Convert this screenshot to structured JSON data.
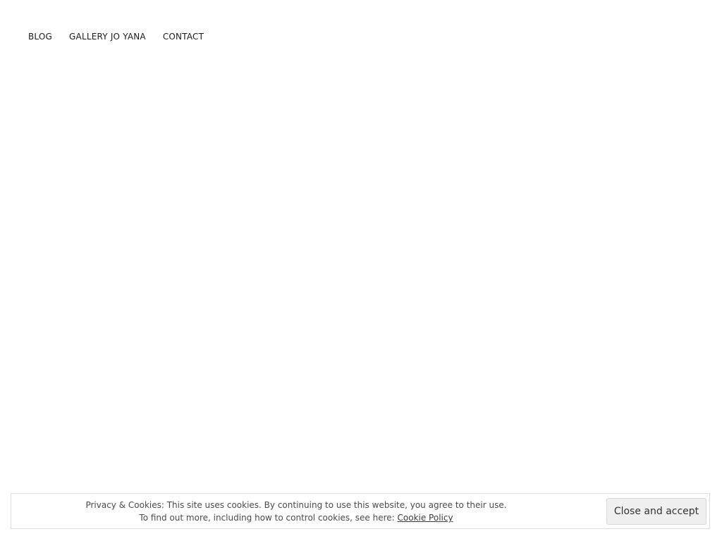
{
  "nav": {
    "items": [
      {
        "label": "BLOG"
      },
      {
        "label": "GALLERY JO YANA"
      },
      {
        "label": "CONTACT"
      }
    ]
  },
  "cookie_banner": {
    "line1": "Privacy & Cookies: This site uses cookies. By continuing to use this website, you agree to their use.",
    "line2_prefix": "To find out more, including how to control cookies, see here: ",
    "policy_link": "Cookie Policy",
    "button_label": "Close and accept",
    "colors": {
      "border": "#dedede",
      "button_background": "#f0f0f0"
    }
  }
}
